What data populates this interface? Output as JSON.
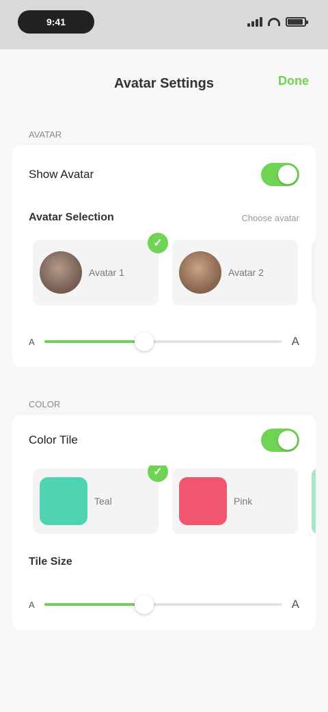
{
  "status_bar": {
    "time": "9:41",
    "battery_level": 0.9
  },
  "nav": {
    "title": "Avatar Settings",
    "done_label": "Done"
  },
  "section1": {
    "header": "AVATAR",
    "toggle_label": "Show Avatar",
    "toggle_on": true,
    "subrow_label": "Avatar Selection",
    "subrow_value": "Choose avatar",
    "options": [
      {
        "name": "Avatar 1",
        "selected": true
      },
      {
        "name": "Avatar 2",
        "selected": false
      }
    ],
    "slider": {
      "min_label": "A",
      "max_label": "A",
      "value": 0.42
    }
  },
  "section2": {
    "header": "COLOR",
    "toggle_label": "Color Tile",
    "toggle_on": true,
    "options": [
      {
        "name": "Teal",
        "color": "#4fd3b1",
        "selected": true
      },
      {
        "name": "Pink",
        "color": "#f0566f",
        "selected": false
      }
    ],
    "subrow_label": "Tile Size",
    "slider": {
      "min_label": "A",
      "max_label": "A",
      "value": 0.42
    }
  },
  "colors": {
    "accent": "#6fd353"
  }
}
